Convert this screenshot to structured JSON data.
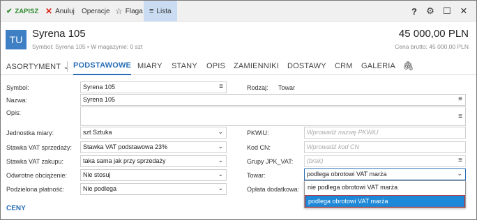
{
  "toolbar": {
    "save_label": "ZAPISZ",
    "cancel_label": "Anuluj",
    "operations_label": "Operacje",
    "flag_label": "Flaga",
    "list_label": "Lista"
  },
  "header": {
    "avatar": "TU",
    "title": "Syrena 105",
    "subtitle": "Symbol: Syrena 105  •  W magazynie: 0 szt",
    "price": "45 000,00 PLN",
    "price_sub": "Cena brutto: 45 000,00 PLN"
  },
  "tabs": [
    {
      "label": "ASORTYMENT ⌄"
    },
    {
      "label": "PODSTAWOWE"
    },
    {
      "label": "MIARY"
    },
    {
      "label": "STANY"
    },
    {
      "label": "OPIS"
    },
    {
      "label": "ZAMIENNIKI"
    },
    {
      "label": "DOSTAWY"
    },
    {
      "label": "CRM"
    },
    {
      "label": "GALERIA"
    }
  ],
  "form": {
    "symbol": {
      "label": "Symbol:",
      "value": "Syrena 105"
    },
    "rodzaj": {
      "label": "Rodzaj:",
      "value": "Towar"
    },
    "nazwa": {
      "label": "Nazwa:",
      "value": "Syrena 105"
    },
    "opis": {
      "label": "Opis:",
      "value": ""
    },
    "jednostka": {
      "label": "Jednostka miary:",
      "value": "szt  Sztuka"
    },
    "pkwiu": {
      "label": "PKWiU:",
      "placeholder": "Wprowadź nazwę PKWiU"
    },
    "vat_sprzedazy": {
      "label": "Stawka VAT sprzedaży:",
      "value": "Stawka VAT podstawowa 23%"
    },
    "kod_cn": {
      "label": "Kod CN:",
      "placeholder": "Wprowadź kod CN"
    },
    "vat_zakupu": {
      "label": "Stawka VAT zakupu:",
      "value": "taka sama jak przy sprzedaży"
    },
    "grupy_jpk": {
      "label": "Grupy JPK_VAT:",
      "placeholder": "(brak)"
    },
    "odwrotne": {
      "label": "Odwrotne obciążenie:",
      "value": "Nie stosuj"
    },
    "towar": {
      "label": "Towar:",
      "value": "podlega obrotowi VAT marża"
    },
    "podzielona": {
      "label": "Podzielona płatność:",
      "value": "Nie podlega"
    },
    "oplata": {
      "label": "Opłata dodatkowa:"
    }
  },
  "dropdown": {
    "options": [
      "nie podlega obrotowi VAT marża",
      "podlega obrotowi VAT marża"
    ],
    "selected_index": 1
  },
  "section_ceny": "CENY",
  "colors": {
    "accent": "#2a6fb7",
    "selected_option": "#1e88d8",
    "highlight_border": "#d8281e",
    "avatar": "#3f7fc4"
  }
}
